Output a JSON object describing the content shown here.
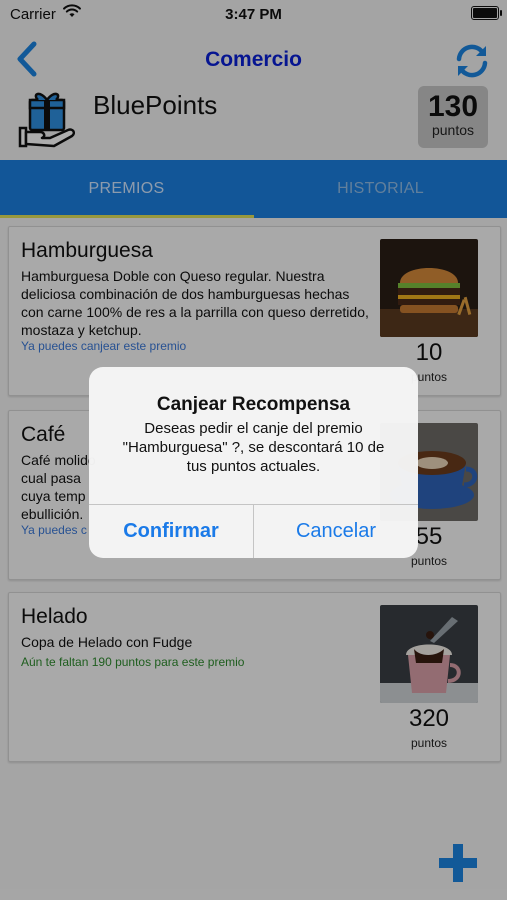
{
  "status_bar": {
    "carrier": "Carrier",
    "time": "3:47 PM"
  },
  "nav": {
    "title": "Comercio"
  },
  "header": {
    "app_name": "BluePoints",
    "points_value": "130",
    "points_label": "puntos"
  },
  "tabs": [
    {
      "label": "PREMIOS",
      "active": true
    },
    {
      "label": "HISTORIAL",
      "active": false
    }
  ],
  "rewards": [
    {
      "title": "Hamburguesa",
      "description": "Hamburguesa Doble con Queso regular. Nuestra deliciosa combinación de dos hamburguesas hechas con carne 100% de res a la parrilla con queso derretido, mostaza y ketchup.",
      "status": "Ya puedes canjear este premio",
      "cost": "10",
      "cost_label": "puntos"
    },
    {
      "title": "Café",
      "description": "Café molido cual pasa cuya temp ebullición.",
      "status": "Ya puedes c",
      "cost": "55",
      "cost_label": "puntos"
    },
    {
      "title": "Helado",
      "description": "Copa de Helado con Fudge",
      "status": "Aún te faltan 190 puntos para este premio",
      "cost": "320",
      "cost_label": "puntos"
    }
  ],
  "alert": {
    "title": "Canjear Recompensa",
    "message": "Deseas pedir el canje del premio \"Hamburguesa\" ?, se descontará 10 de tus puntos actuales.",
    "confirm": "Confirmar",
    "cancel": "Cancelar"
  },
  "colors": {
    "accent": "#1b7fe0",
    "nav_title": "#0a1fd6",
    "available_status": "#3a78d8",
    "missing_status": "#2e8b2e",
    "alert_button": "#1a7ae8"
  },
  "icons": [
    "back-chevron-icon",
    "refresh-icon",
    "gift-hand-icon",
    "add-icon"
  ]
}
